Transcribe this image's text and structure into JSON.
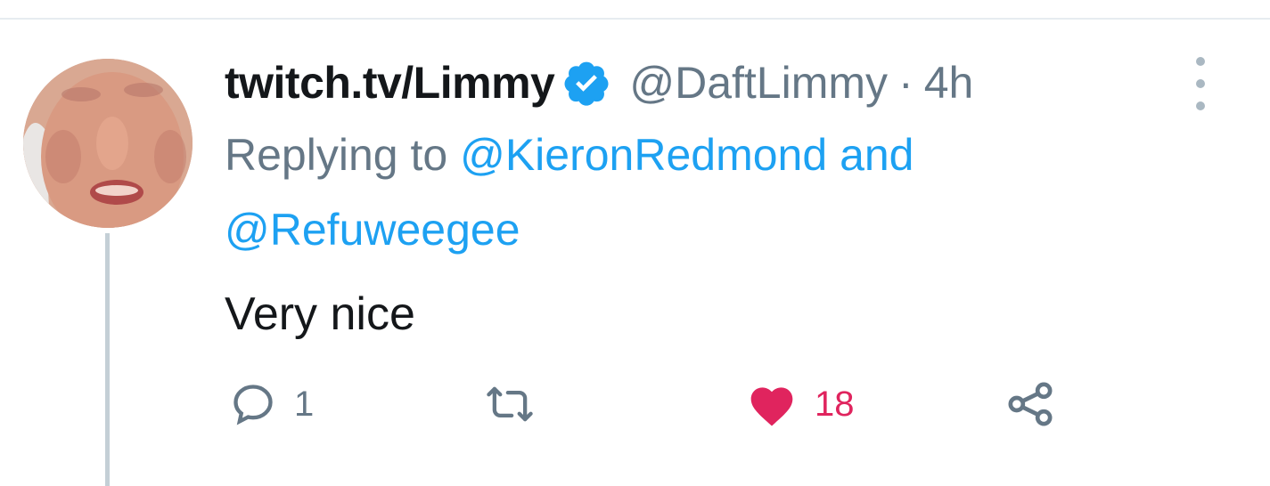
{
  "tweet": {
    "display_name": "twitch.tv/Limmy",
    "handle": "@DaftLimmy",
    "separator": "·",
    "time": "4h",
    "reply_prefix": "Replying to",
    "reply_mention_1": "@KieronRedmond",
    "reply_conjunction": "and",
    "reply_mention_2": "@Refuweegee",
    "text": "Very nice"
  },
  "actions": {
    "reply_count": "1",
    "like_count": "18"
  },
  "icons": {
    "verified": "verified-badge-icon",
    "more": "more-vertical-icon",
    "reply": "comment-icon",
    "retweet": "retweet-icon",
    "like": "heart-icon",
    "share": "share-icon"
  },
  "colors": {
    "accent": "#1da1f2",
    "like": "#e0245e",
    "secondary_text": "#657786"
  }
}
